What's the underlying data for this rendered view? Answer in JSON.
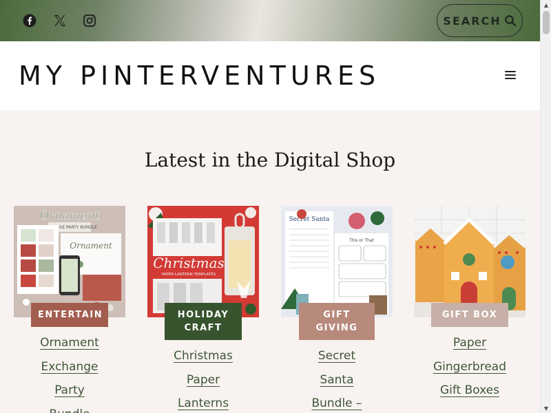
{
  "topbar": {
    "social_icons": [
      "facebook-icon",
      "x-twitter-icon",
      "instagram-icon"
    ],
    "search_label": "SEARCH"
  },
  "header": {
    "site_title": "MY PINTERVENTURES",
    "menu_icon": "hamburger-menu-icon"
  },
  "main": {
    "section_heading": "Latest in the Digital Shop",
    "products": [
      {
        "badge": "ENTERTAIN",
        "badge_color": "#a35d4f",
        "title_lines": [
          "Ornament",
          "Exchange",
          "Party",
          "Bundle"
        ]
      },
      {
        "badge": "HOLIDAY CRAFT",
        "badge_color": "#38542f",
        "title_lines": [
          "Christmas",
          "Paper",
          "Lanterns"
        ]
      },
      {
        "badge": "GIFT GIVING",
        "badge_color": "#b88a7c",
        "title_lines": [
          "Secret",
          "Santa",
          "Bundle –"
        ]
      },
      {
        "badge": "GIFT BOX",
        "badge_color": "#c7b0a7",
        "title_lines": [
          "Paper",
          "Gingerbread",
          "Gift Boxes"
        ]
      }
    ]
  },
  "colors": {
    "accent_green": "#3e5636",
    "page_bg": "#f8f3f1"
  }
}
